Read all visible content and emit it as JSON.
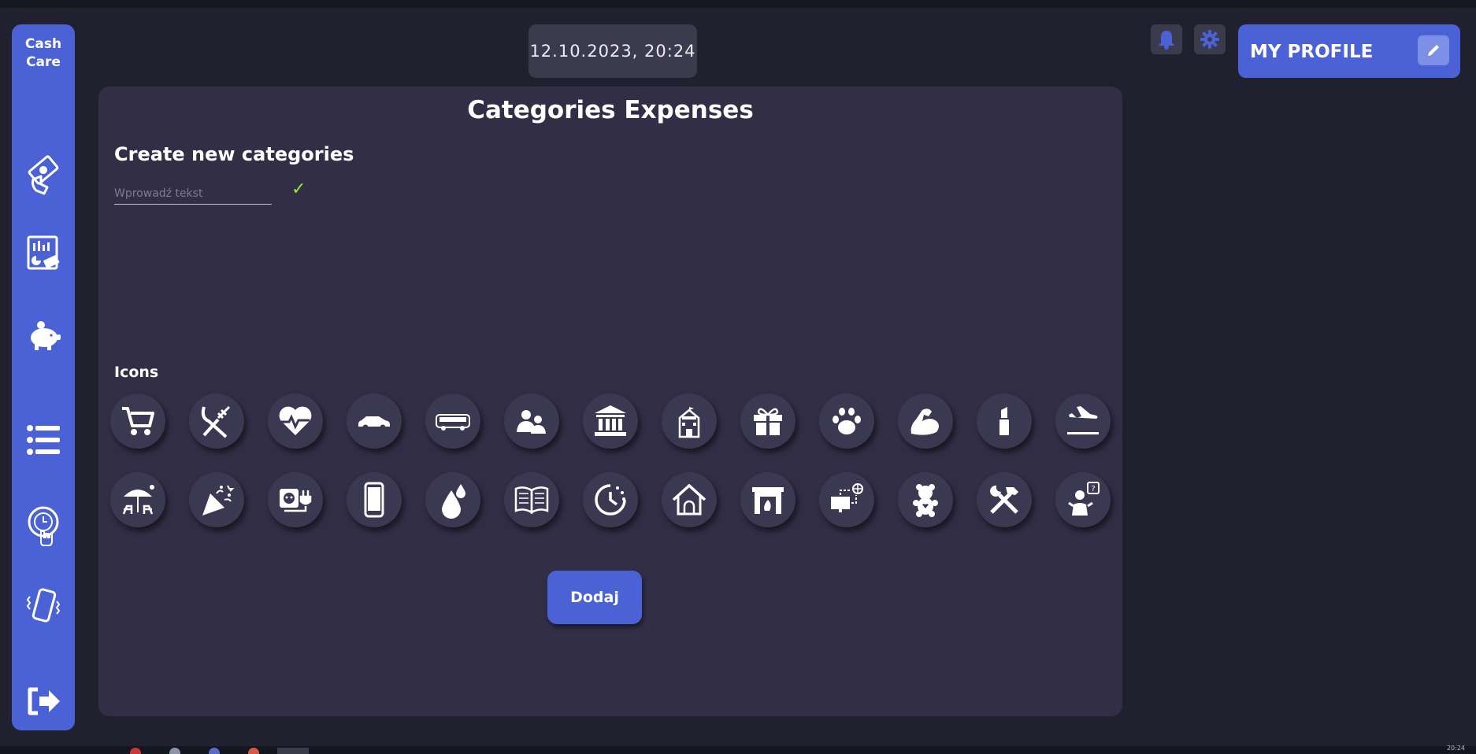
{
  "app": {
    "brand_line1": "Cash",
    "brand_line2": "Care"
  },
  "header": {
    "datetime": "12.10.2023, 20:24",
    "profile_label": "MY PROFILE"
  },
  "sidebar": {
    "items": [
      {
        "icon": "payment-hand-icon"
      },
      {
        "icon": "reports-icon"
      },
      {
        "icon": "piggy-bank-icon"
      },
      {
        "icon": "list-icon"
      },
      {
        "icon": "recurring-time-icon"
      },
      {
        "icon": "phone-vibrate-icon"
      }
    ],
    "logout_icon": "logout-icon"
  },
  "panel": {
    "title": "Categories Expenses",
    "subtitle": "Create new categories",
    "input_placeholder": "Wprowadź tekst",
    "input_value": "",
    "confirm_glyph": "✓",
    "icons_label": "Icons",
    "add_button": "Dodaj"
  },
  "icons": [
    "shopping-cart-icon",
    "fork-knife-icon",
    "heart-pulse-icon",
    "car-icon",
    "bus-icon",
    "family-icon",
    "bank-icon",
    "school-icon",
    "gift-icon",
    "paw-icon",
    "muscle-icon",
    "lipstick-icon",
    "plane-landing-icon",
    "beach-umbrella-icon",
    "party-popper-icon",
    "electric-outlet-icon",
    "smartphone-icon",
    "water-drop-icon",
    "open-book-icon",
    "clock-icon",
    "house-icon",
    "fireplace-icon",
    "computer-network-icon",
    "teddy-bear-icon",
    "tools-icon",
    "person-question-icon"
  ],
  "taskbar": {
    "clock": "20:24"
  },
  "colors": {
    "accent": "#4a62d6",
    "panel": "#322e46",
    "background": "#20202e",
    "confirm": "#9be830"
  }
}
